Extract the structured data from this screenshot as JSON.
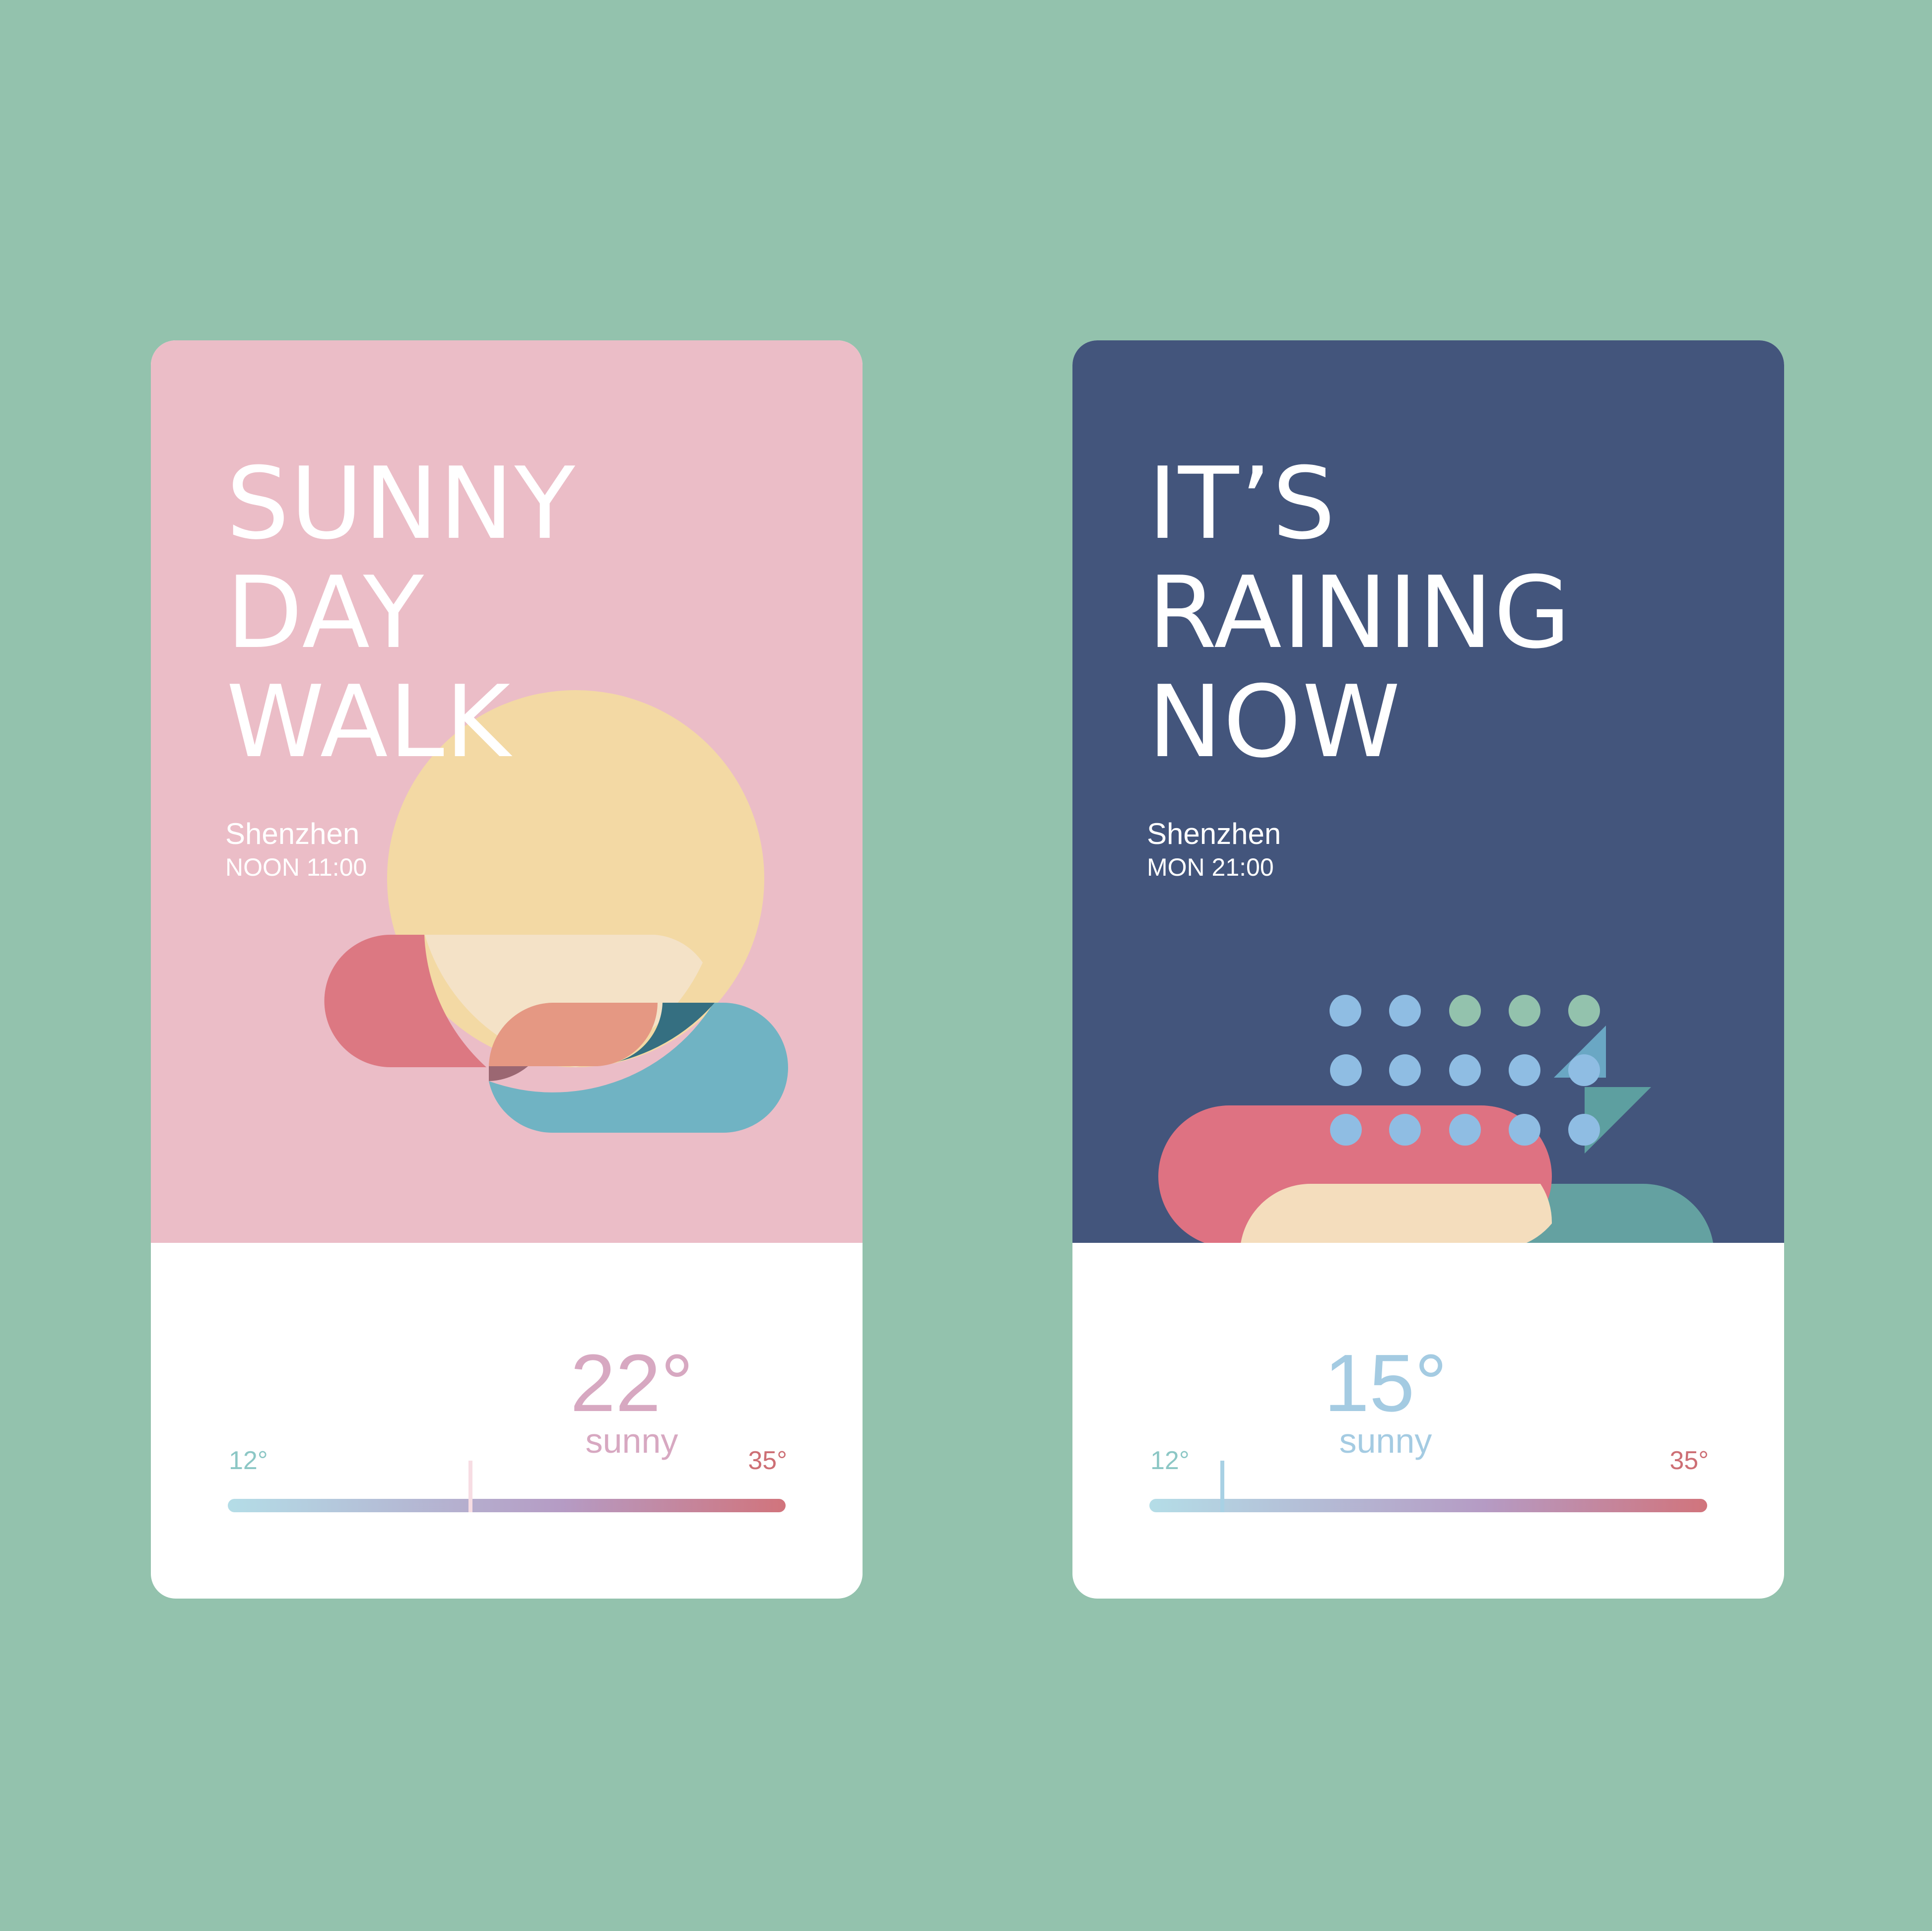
{
  "cards": [
    {
      "headline": [
        "SUNNY",
        "DAY",
        "WALK"
      ],
      "city": "Shenzhen",
      "time": "NOON 11:00",
      "temperature": "22°",
      "condition": "sunny",
      "range": {
        "min_label": "12°",
        "max_label": "35°",
        "min": 12,
        "max": 35,
        "current": 22
      },
      "colors": {
        "hero": "#ebbdc7",
        "accent": "#d7a8c1"
      },
      "illustration": "sun-with-clouds"
    },
    {
      "headline": [
        "IT’S",
        "RAINING",
        "NOW"
      ],
      "city": "Shenzhen",
      "time": "MON 21:00",
      "temperature": "15°",
      "condition": "sunny",
      "range": {
        "min_label": "12°",
        "max_label": "35°",
        "min": 12,
        "max": 35,
        "current": 15
      },
      "colors": {
        "hero": "#43557c",
        "accent": "#a4cbe2"
      },
      "illustration": "rain-clouds-with-lightning"
    }
  ],
  "colors": {
    "page_background": "#93c2ad",
    "range_gradient": [
      "#b4dde7",
      "#b59bc4",
      "#d1747c"
    ]
  }
}
